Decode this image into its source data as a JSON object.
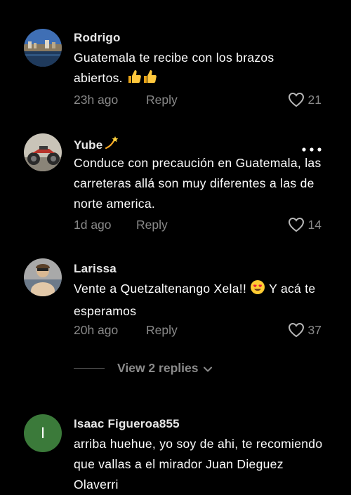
{
  "colors": {
    "background": "#000000",
    "text": "#ffffff",
    "muted": "#8a8a8a",
    "initial_avatar": "#3b7a3a"
  },
  "comments": [
    {
      "author": "Rodrigo",
      "text": "Guatemala te recibe con los brazos abiertos. 👍👍",
      "text_main": "Guatemala te recibe con los brazos abiertos.",
      "emoji": [
        "thumbs-up-icon",
        "thumbs-up-icon"
      ],
      "time": "23h ago",
      "reply_label": "Reply",
      "likes": "21"
    },
    {
      "author": "Yube",
      "author_emoji": "dizzy-icon",
      "text": "Conduce con precaución en Guatemala, las carreteras allá son muy diferentes a las de norte america.",
      "time": "1d ago",
      "reply_label": "Reply",
      "likes": "14"
    },
    {
      "author": "Larissa",
      "text_before": "Vente a Quetzaltenango Xela!!",
      "emoji": "heart-eyes-icon",
      "text_after": "Y acá te esperamos",
      "time": "20h ago",
      "reply_label": "Reply",
      "likes": "37"
    },
    {
      "author": "Isaac Figueroa855",
      "avatar_initial": "I",
      "text": "arriba huehue, yo soy de ahi, te recomiendo que vallas a el mirador Juan Dieguez Olaverri"
    }
  ],
  "view_replies_label": "View 2 replies"
}
